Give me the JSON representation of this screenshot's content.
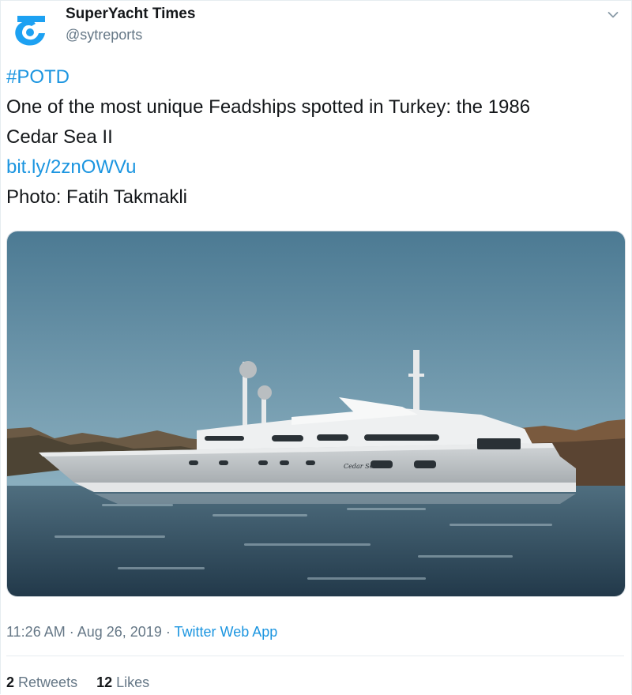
{
  "tweet": {
    "author": {
      "display_name": "SuperYacht Times",
      "handle": "@sytreports",
      "avatar_icon": "superyacht-times-logo-icon"
    },
    "menu_icon": "chevron-down-icon",
    "text_lines": {
      "hashtag": "#POTD",
      "line1": "One of the most unique Feadships spotted in Turkey: the 1986",
      "line2": "Cedar Sea II",
      "link": "bit.ly/2znOWVu",
      "credit": "Photo: Fatih Takmakli"
    },
    "media": {
      "hull_lettering": "Cedar Sea 2"
    },
    "timestamp": {
      "time": "11:26 AM",
      "sep1": " · ",
      "date": "Aug 26, 2019",
      "sep2": " · ",
      "source": "Twitter Web App"
    },
    "stats": {
      "retweets_count": "2",
      "retweets_label": "Retweets",
      "likes_count": "12",
      "likes_label": "Likes"
    }
  },
  "colors": {
    "link": "#1b95e0",
    "brand": "#1da1f2",
    "text": "#14171a",
    "secondary": "#657786"
  }
}
